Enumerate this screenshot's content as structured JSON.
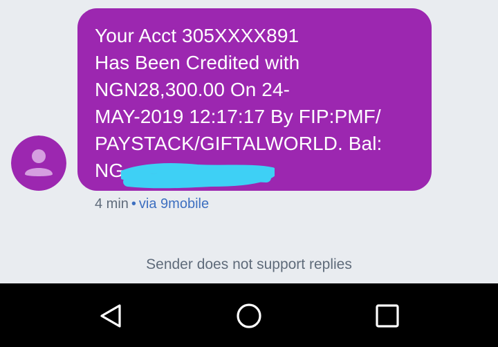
{
  "message": {
    "lines": [
      "Your Acct 305XXXX891",
      "Has Been Credited with",
      "NGN28,300.00 On 24-",
      "MAY-2019 12:17:17 By FIP:PMF/",
      "PAYSTACK/GIFTALWORLD. Bal:",
      "NG"
    ],
    "time": "4 min",
    "separator": "•",
    "via": "via 9mobile"
  },
  "footer": {
    "no_reply": "Sender does not support replies"
  },
  "navigation": {
    "buttons": [
      "back",
      "home",
      "recents"
    ]
  },
  "colors": {
    "bubble": "#9c27b0",
    "avatar": "#9c27b0",
    "redaction": "#3ed0f5",
    "background": "#e9ecf0",
    "meta_link": "#3d6fc0"
  }
}
